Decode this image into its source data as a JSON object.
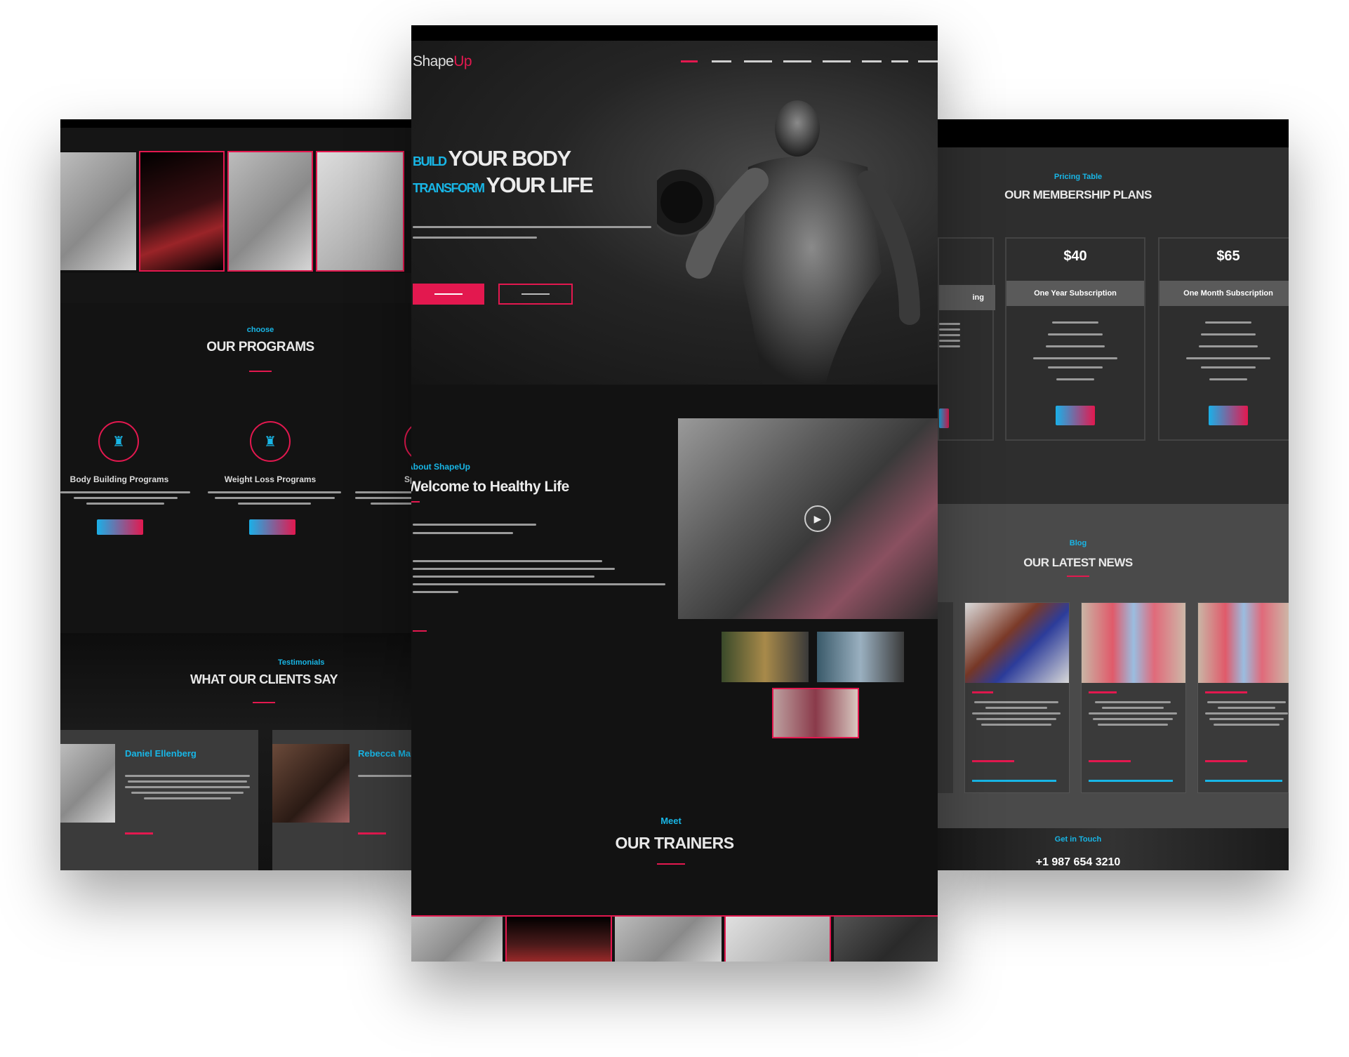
{
  "left": {
    "programs": {
      "eyebrow": "choose",
      "title": "OUR PROGRAMS",
      "items": [
        {
          "label": "Body Building Programs"
        },
        {
          "label": "Weight Loss Programs"
        },
        {
          "label": "Sp"
        }
      ]
    },
    "testimonials": {
      "eyebrow": "Testimonials",
      "title": "WHAT OUR CLIENTS SAY",
      "clients": [
        {
          "name": "Daniel Ellenberg"
        },
        {
          "name": "Rebecca Martin"
        }
      ]
    }
  },
  "center": {
    "logo": {
      "part1": "Shape",
      "part2": "Up"
    },
    "hero": {
      "line1_accent": "BUILD",
      "line1_main": "YOUR BODY",
      "line2_accent": "TRANSFORM",
      "line2_main": "YOUR LIFE"
    },
    "about": {
      "eyebrow": "About ShapeUp",
      "title": "Welcome to Healthy Life"
    },
    "trainers": {
      "eyebrow": "Meet",
      "title": "OUR TRAINERS"
    }
  },
  "right": {
    "pricing": {
      "eyebrow": "Pricing Table",
      "title": "OUR MEMBERSHIP PLANS",
      "plans": [
        {
          "price": "$40",
          "label": "One Year Subscription"
        },
        {
          "price": "$65",
          "label": "One Month Subscription"
        }
      ],
      "partial_label": "ing"
    },
    "blog": {
      "eyebrow": "Blog",
      "title": "OUR LATEST NEWS"
    },
    "contact": {
      "eyebrow": "Get in Touch",
      "phone": "+1 987 654 3210"
    }
  },
  "colors": {
    "accent": "#18b6e6",
    "brand": "#e3184f",
    "bg": "#151515",
    "card": "#3b3b3b"
  }
}
